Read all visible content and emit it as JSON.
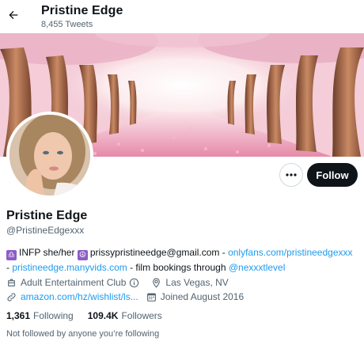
{
  "header": {
    "title": "Pristine Edge",
    "tweet_count": "8,455 Tweets"
  },
  "profile": {
    "name": "Pristine Edge",
    "handle": "@PristineEdgexxx",
    "more_label": "•••",
    "follow_label": "Follow"
  },
  "bio": {
    "emoji1": "♎",
    "text1": "INFP she/her",
    "emoji2": "☮",
    "text2": "prissypristineedge@gmail.com -",
    "link1": "onlyfans.com/pristineedgexxx",
    "dash": "-",
    "link2": "pristineedge.manyvids.com",
    "text3": "- film bookings through",
    "link3": "@nexxxtlevel"
  },
  "meta": {
    "category": "Adult Entertainment Club",
    "location": "Las Vegas, NV",
    "website": "amazon.com/hz/wishlist/ls...",
    "joined": "Joined August 2016"
  },
  "stats": {
    "following_count": "1,361",
    "following_label": "Following",
    "followers_count": "109.4K",
    "followers_label": "Followers"
  },
  "footer": {
    "not_followed": "Not followed by anyone you’re following"
  },
  "colors": {
    "accent": "#1d9bf0",
    "text_primary": "#0f1419",
    "text_secondary": "#536471",
    "follow_button_bg": "#0f1419",
    "banner_pink": "#e8a0b8",
    "emoji_purple": "#8d5dc7"
  },
  "icons": {
    "back": "arrow-left-icon",
    "more": "more-dots-icon",
    "category": "briefcase-icon",
    "info": "info-circle-icon",
    "location": "location-pin-icon",
    "website": "link-icon",
    "joined": "calendar-icon"
  }
}
